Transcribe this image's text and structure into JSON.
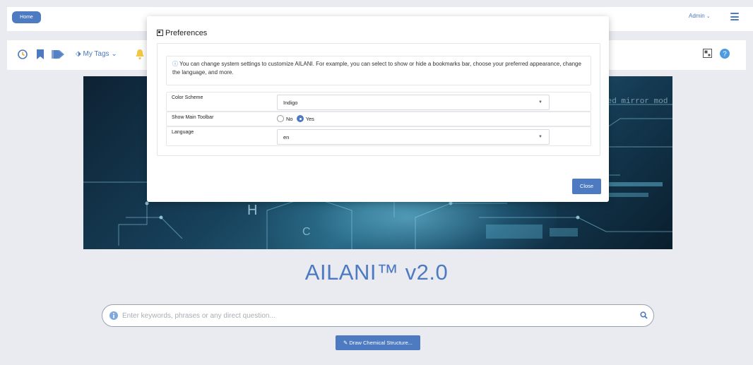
{
  "topbar": {
    "home_label": "Home",
    "admin_label": "Admin",
    "admin_caret": "⌄"
  },
  "toolbar": {
    "icons": [
      "history-icon",
      "bookmark-icon",
      "tags-icon",
      "bell-icon",
      "layout-icon",
      "help-icon"
    ],
    "my_tags_label": "My Tags",
    "my_tags_caret": "⌄"
  },
  "hero": {
    "code_text": "ted mirror mod"
  },
  "main": {
    "title": "AILANI™ v2.0",
    "search_placeholder": "Enter keywords, phrases or any direct question...",
    "draw_button_label": "Draw Chemical Structure..."
  },
  "modal": {
    "title": "Preferences",
    "notice": "You can change system settings to customize AILANI. For example, you can select to show or hide a bookmarks bar, choose your preferred appearance, change the language, and more.",
    "color_scheme_label": "Color Scheme",
    "color_scheme_value": "Indigo",
    "toolbar_label": "Show Main Toolbar",
    "toolbar_no": "No",
    "toolbar_yes": "Yes",
    "toolbar_selected": "Yes",
    "language_label": "Language",
    "language_value": "en",
    "close_label": "Close"
  },
  "colors": {
    "accent": "#4d7ac0",
    "page_bg": "#e9ebf1"
  }
}
